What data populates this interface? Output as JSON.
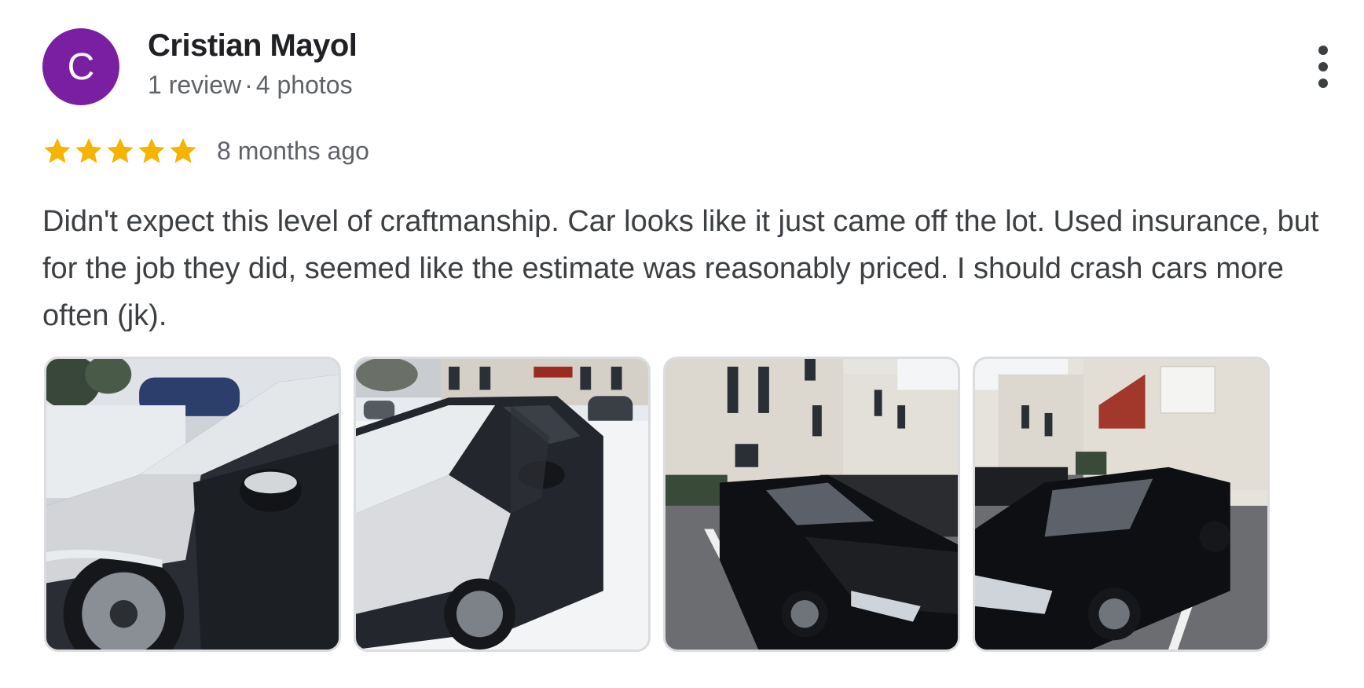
{
  "reviewer": {
    "initial": "C",
    "name": "Cristian Mayol",
    "review_count": "1 review",
    "separator": "·",
    "photo_count": "4 photos",
    "avatar_color": "#7b1fa2"
  },
  "review": {
    "rating": 5,
    "max_rating": 5,
    "date": "8 months ago",
    "text": "Didn't expect this level of craftmanship. Car looks like it just came off the lot. Used insurance, but for the job they did, seemed like the estimate was reasonably priced. I should crash cars more often (jk).",
    "star_color": "#f4b400"
  },
  "actions": {
    "more_icon": "more-vertical-icon"
  },
  "photos": [
    {
      "scene": "damaged black car covered in snow, close-up of front fender"
    },
    {
      "scene": "black sedan covered in snow in parking lot"
    },
    {
      "scene": "repaired black sedan parked in front of apartment buildings"
    },
    {
      "scene": "repaired black sedan, front view, apartment buildings behind"
    }
  ]
}
